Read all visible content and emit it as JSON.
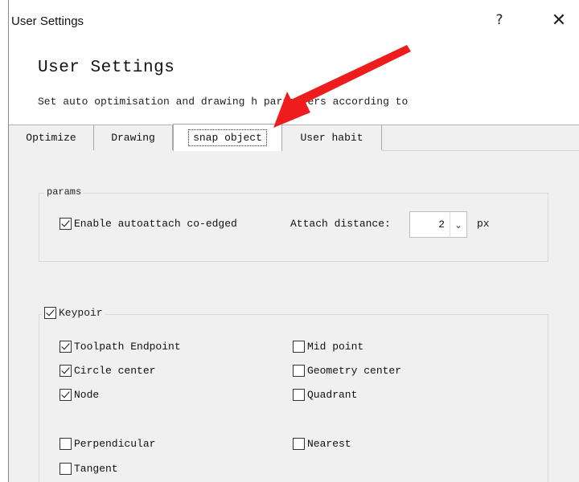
{
  "window": {
    "title": "User Settings",
    "help_glyph": "?",
    "close_glyph": "✕"
  },
  "header": {
    "title": "User Settings",
    "description": "Set auto optimisation and drawing h      parameters according to"
  },
  "tabs": [
    {
      "label": "Optimize",
      "active": false
    },
    {
      "label": "Drawing",
      "active": false
    },
    {
      "label": "snap object",
      "active": true
    },
    {
      "label": "User habit",
      "active": false
    }
  ],
  "params": {
    "legend": "params",
    "enable_autoattach": {
      "label": "Enable autoattach co-edged",
      "checked": true
    },
    "attach_distance_label": "Attach distance:",
    "attach_distance_value": "2",
    "unit": "px"
  },
  "keypoint": {
    "legend": "Keypoir",
    "legend_checked": true,
    "options": [
      {
        "label": "Toolpath Endpoint",
        "checked": true
      },
      {
        "label": "Mid point",
        "checked": false
      },
      {
        "label": "Circle center",
        "checked": true
      },
      {
        "label": "Geometry center",
        "checked": false
      },
      {
        "label": "Node",
        "checked": true
      },
      {
        "label": "Quadrant",
        "checked": false
      },
      {
        "label": "Perpendicular",
        "checked": false
      },
      {
        "label": "Nearest",
        "checked": false
      },
      {
        "label": "Tangent",
        "checked": false
      }
    ]
  },
  "colors": {
    "annotation_arrow": "#ee1c1c",
    "panel_bg": "#f0f0f0"
  }
}
